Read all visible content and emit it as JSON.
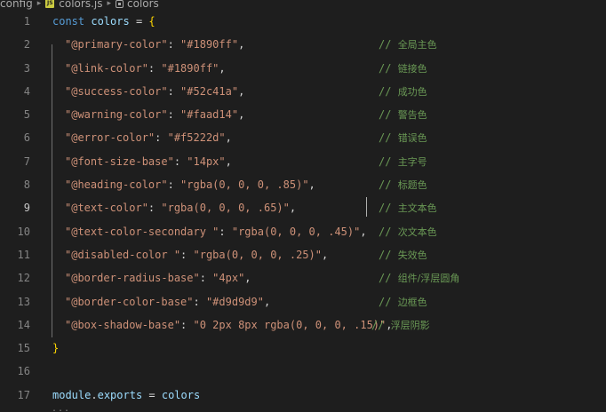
{
  "breadcrumb": {
    "folder": "config",
    "file": "colors.js",
    "file_icon_label": "JS",
    "symbol": "colors"
  },
  "lines": [
    {
      "num": "1",
      "parts": [
        [
          "kw",
          "const "
        ],
        [
          "var",
          "colors"
        ],
        [
          "punc",
          " = "
        ],
        [
          "brace",
          "{"
        ]
      ],
      "comment": ""
    },
    {
      "num": "2",
      "parts": [
        [
          "str",
          "\"@primary-color\""
        ],
        [
          "punc",
          ": "
        ],
        [
          "str",
          "\"#1890ff\""
        ],
        [
          "punc",
          ","
        ]
      ],
      "comment": "全局主色"
    },
    {
      "num": "3",
      "parts": [
        [
          "str",
          "\"@link-color\""
        ],
        [
          "punc",
          ": "
        ],
        [
          "str",
          "\"#1890ff\""
        ],
        [
          "punc",
          ","
        ]
      ],
      "comment": "链接色"
    },
    {
      "num": "4",
      "parts": [
        [
          "str",
          "\"@success-color\""
        ],
        [
          "punc",
          ": "
        ],
        [
          "str",
          "\"#52c41a\""
        ],
        [
          "punc",
          ","
        ]
      ],
      "comment": "成功色"
    },
    {
      "num": "5",
      "parts": [
        [
          "str",
          "\"@warning-color\""
        ],
        [
          "punc",
          ": "
        ],
        [
          "str",
          "\"#faad14\""
        ],
        [
          "punc",
          ","
        ]
      ],
      "comment": "警告色"
    },
    {
      "num": "6",
      "parts": [
        [
          "str",
          "\"@error-color\""
        ],
        [
          "punc",
          ": "
        ],
        [
          "str",
          "\"#f5222d\""
        ],
        [
          "punc",
          ","
        ]
      ],
      "comment": "错误色"
    },
    {
      "num": "7",
      "parts": [
        [
          "str",
          "\"@font-size-base\""
        ],
        [
          "punc",
          ": "
        ],
        [
          "str",
          "\"14px\""
        ],
        [
          "punc",
          ","
        ]
      ],
      "comment": "主字号"
    },
    {
      "num": "8",
      "parts": [
        [
          "str",
          "\"@heading-color\""
        ],
        [
          "punc",
          ": "
        ],
        [
          "str",
          "\"rgba(0, 0, 0, .85)\""
        ],
        [
          "punc",
          ","
        ]
      ],
      "comment": "标题色"
    },
    {
      "num": "9",
      "parts": [
        [
          "str",
          "\"@text-color\""
        ],
        [
          "punc",
          ": "
        ],
        [
          "str",
          "\"rgba(0, 0, 0, .65)\""
        ],
        [
          "punc",
          ","
        ]
      ],
      "comment": "主文本色",
      "active": true
    },
    {
      "num": "10",
      "parts": [
        [
          "str",
          "\"@text-color-secondary \""
        ],
        [
          "punc",
          ": "
        ],
        [
          "str",
          "\"rgba(0, 0, 0, .45)\""
        ],
        [
          "punc",
          ","
        ]
      ],
      "comment": "次文本色"
    },
    {
      "num": "11",
      "parts": [
        [
          "str",
          "\"@disabled-color \""
        ],
        [
          "punc",
          ": "
        ],
        [
          "str",
          "\"rgba(0, 0, 0, .25)\""
        ],
        [
          "punc",
          ","
        ]
      ],
      "comment": "失效色"
    },
    {
      "num": "12",
      "parts": [
        [
          "str",
          "\"@border-radius-base\""
        ],
        [
          "punc",
          ": "
        ],
        [
          "str",
          "\"4px\""
        ],
        [
          "punc",
          ","
        ]
      ],
      "comment": "组件/浮层圆角"
    },
    {
      "num": "13",
      "parts": [
        [
          "str",
          "\"@border-color-base\""
        ],
        [
          "punc",
          ": "
        ],
        [
          "str",
          "\"#d9d9d9\""
        ],
        [
          "punc",
          ","
        ]
      ],
      "comment": "边框色"
    },
    {
      "num": "14",
      "parts": [
        [
          "str",
          "\"@box-shadow-base\""
        ],
        [
          "punc",
          ": "
        ],
        [
          "str",
          "\"0 2px 8px rgba(0, 0, 0, .15)\""
        ],
        [
          "punc",
          ","
        ]
      ],
      "comment": "浮层阴影",
      "tight": true
    },
    {
      "num": "15",
      "parts": [
        [
          "brace",
          "}"
        ]
      ],
      "comment": ""
    },
    {
      "num": "16",
      "parts": [],
      "comment": ""
    },
    {
      "num": "17",
      "parts": [
        [
          "var",
          "module"
        ],
        [
          "punc",
          "."
        ],
        [
          "var",
          "exports"
        ],
        [
          "punc",
          " = "
        ],
        [
          "var",
          "colors"
        ]
      ],
      "comment": ""
    }
  ],
  "comment_prefix": "// ",
  "fold_marker": "..."
}
